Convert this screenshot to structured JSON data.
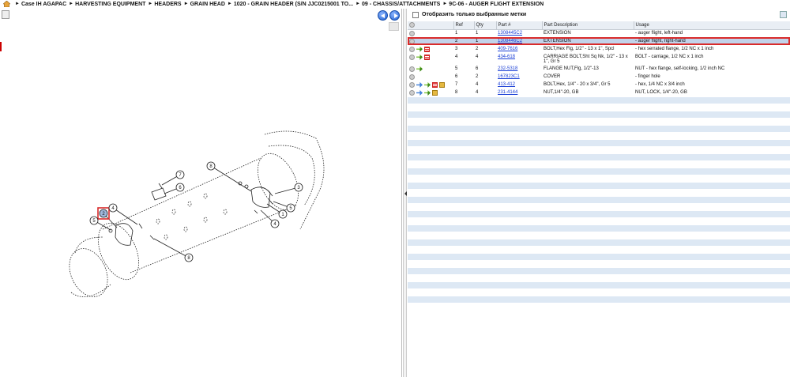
{
  "breadcrumb": [
    "Case IH AGAPAC",
    "HARVESTING EQUIPMENT",
    "HEADERS",
    "GRAIN HEAD",
    "1020 - GRAIN HEADER (S/N JJC0215001 TO...",
    "09 - CHASSIS/ATTACHMENTS",
    "9C-06 - AUGER FLIGHT EXTENSION"
  ],
  "filter": {
    "label": "Отобразить только выбранные метки"
  },
  "table": {
    "headers": {
      "ref": "Ref",
      "qty": "Qty",
      "part": "Part #",
      "desc": "Part Description",
      "usage": "Usage"
    },
    "rows": [
      {
        "icons": [],
        "ref": "1",
        "qty": "1",
        "part": "1308445C2",
        "desc": "EXTENSION",
        "usage": "- auger flight, left-hand"
      },
      {
        "icons": [],
        "ref": "2",
        "qty": "1",
        "part": "1308446C2",
        "desc": "EXTENSION",
        "usage": "- auger flight, right-hand",
        "selected": true
      },
      {
        "icons": [
          "arrow",
          "doc"
        ],
        "ref": "3",
        "qty": "2",
        "part": "409-7616",
        "desc": "BOLT,Hex Flg, 1/2\" - 13 x 1\", Spcl",
        "usage": "- hex serrated flange, 1/2 NC x 1 inch"
      },
      {
        "icons": [
          "arrow",
          "doc"
        ],
        "ref": "4",
        "qty": "4",
        "part": "434-618",
        "desc": "CARRIAGE BOLT,Sht Sq Nk, 1/2\" - 13 x 1\", Gr 5",
        "usage": "BOLT - carriage, 1/2 NC x 1 inch"
      },
      {
        "icons": [
          "arrow"
        ],
        "ref": "5",
        "qty": "6",
        "part": "232-5318",
        "desc": "FLANGE NUT,Flg, 1/2\"-13",
        "usage": "NUT - hex flange, self-locking, 1/2 inch NC"
      },
      {
        "icons": [],
        "ref": "6",
        "qty": "2",
        "part": "167823C1",
        "desc": "COVER",
        "usage": "- finger hole"
      },
      {
        "icons": [
          "blue",
          "arrow",
          "doc",
          "box"
        ],
        "ref": "7",
        "qty": "4",
        "part": "413-412",
        "desc": "BOLT,Hex, 1/4\" - 20 x 3/4\", Gr 5",
        "usage": "- hex, 1/4 NC x 3/4 inch"
      },
      {
        "icons": [
          "blue",
          "arrow",
          "box"
        ],
        "ref": "8",
        "qty": "4",
        "part": "231-4144",
        "desc": "NUT,1/4\"-20, GB",
        "usage": "NUT, LOCK,  1/4\"-20, GB"
      }
    ]
  },
  "diagram": {
    "callouts": [
      "7",
      "6",
      "8",
      "3",
      "5",
      "1",
      "4",
      "2",
      "4",
      "5",
      "8"
    ],
    "selected_callout": "2"
  },
  "colors": {
    "selection_outline": "#d92b2b",
    "link": "#1a3fd6",
    "stripe": "#dde8f4"
  }
}
